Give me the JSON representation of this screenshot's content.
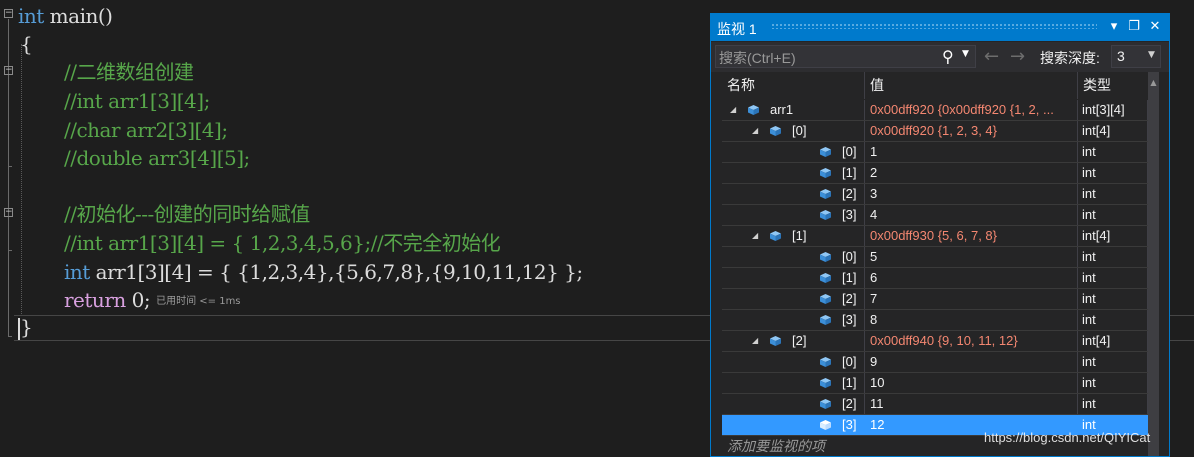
{
  "editor": {
    "lines": {
      "l1_kw": "int",
      "l1_rest": " main()",
      "l2": "{",
      "l3": "//二维数组创建",
      "l4": "//int arr1[3][4];",
      "l5": "//char arr2[3][4];",
      "l6": "//double arr3[4][5];",
      "l8": "//初始化---创建的同时给赋值",
      "l9": "//int arr1[3][4] = { 1,2,3,4,5,6};//不完全初始化",
      "l10_kw": "int",
      "l10_rest": " arr1[3][4] = { {1,2,3,4},{5,6,7,8},{9,10,11,12} };",
      "l11_kw": "return",
      "l11_rest": " 0;",
      "l11_perf": "已用时间 <= 1ms",
      "l12": "}"
    }
  },
  "watch": {
    "title": "监视 1",
    "title_buttons": {
      "dropdown": "▾",
      "maximize": "❐",
      "close": "✕"
    },
    "search_placeholder": "搜索(Ctrl+E)",
    "search_icon": "search-icon",
    "depth_label": "搜索深度:",
    "depth_value": "3",
    "columns": {
      "name": "名称",
      "value": "值",
      "type": "类型"
    },
    "rows": [
      {
        "name": "arr1",
        "value": "0x00dff920 {0x00dff920 {1, 2, ...",
        "type": "int[3][4]"
      },
      {
        "name": "[0]",
        "value": "0x00dff920 {1, 2, 3, 4}",
        "type": "int[4]"
      },
      {
        "name": "[0]",
        "value": "1",
        "type": "int"
      },
      {
        "name": "[1]",
        "value": "2",
        "type": "int"
      },
      {
        "name": "[2]",
        "value": "3",
        "type": "int"
      },
      {
        "name": "[3]",
        "value": "4",
        "type": "int"
      },
      {
        "name": "[1]",
        "value": "0x00dff930 {5, 6, 7, 8}",
        "type": "int[4]"
      },
      {
        "name": "[0]",
        "value": "5",
        "type": "int"
      },
      {
        "name": "[1]",
        "value": "6",
        "type": "int"
      },
      {
        "name": "[2]",
        "value": "7",
        "type": "int"
      },
      {
        "name": "[3]",
        "value": "8",
        "type": "int"
      },
      {
        "name": "[2]",
        "value": "0x00dff940 {9, 10, 11, 12}",
        "type": "int[4]"
      },
      {
        "name": "[0]",
        "value": "9",
        "type": "int"
      },
      {
        "name": "[1]",
        "value": "10",
        "type": "int"
      },
      {
        "name": "[2]",
        "value": "11",
        "type": "int"
      },
      {
        "name": "[3]",
        "value": "12",
        "type": "int"
      }
    ],
    "add_placeholder": "添加要监视的项"
  },
  "watermark": "https://blog.csdn.net/QIYICat",
  "colors": {
    "accent": "#007acc",
    "changed_value": "#f48771",
    "selection": "#3399ff",
    "comment": "#57a64a",
    "keyword": "#569cd6"
  }
}
